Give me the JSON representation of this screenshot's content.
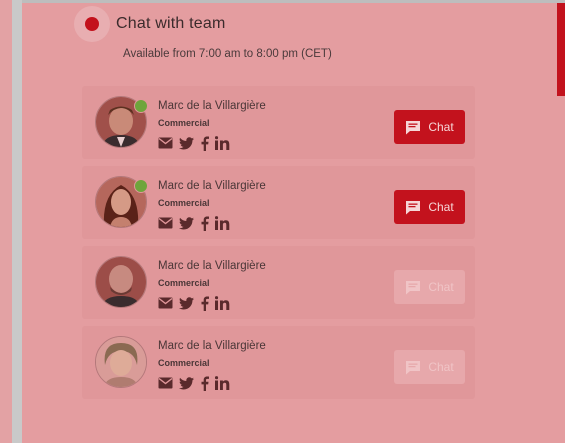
{
  "header": {
    "title": "Chat with team",
    "availability": "Available from 7:00 am to 8:00 pm (CET)"
  },
  "colors": {
    "accent": "#c3121d",
    "online": "#6ea53c",
    "panel": "#e49da0"
  },
  "contacts": [
    {
      "name": "Marc de la Villargière",
      "role": "Commercial",
      "online": true,
      "chat_label": "Chat",
      "chat_enabled": true,
      "social": [
        "email-icon",
        "twitter-icon",
        "facebook-icon",
        "linkedin-icon"
      ]
    },
    {
      "name": "Marc de la Villargière",
      "role": "Commercial",
      "online": true,
      "chat_label": "Chat",
      "chat_enabled": true,
      "social": [
        "email-icon",
        "twitter-icon",
        "facebook-icon",
        "linkedin-icon"
      ]
    },
    {
      "name": "Marc de la Villargière",
      "role": "Commercial",
      "online": false,
      "chat_label": "Chat",
      "chat_enabled": false,
      "social": [
        "email-icon",
        "twitter-icon",
        "facebook-icon",
        "linkedin-icon"
      ]
    },
    {
      "name": "Marc de la Villargière",
      "role": "Commercial",
      "online": false,
      "chat_label": "Chat",
      "chat_enabled": false,
      "social": [
        "email-icon",
        "twitter-icon",
        "facebook-icon",
        "linkedin-icon"
      ]
    }
  ]
}
